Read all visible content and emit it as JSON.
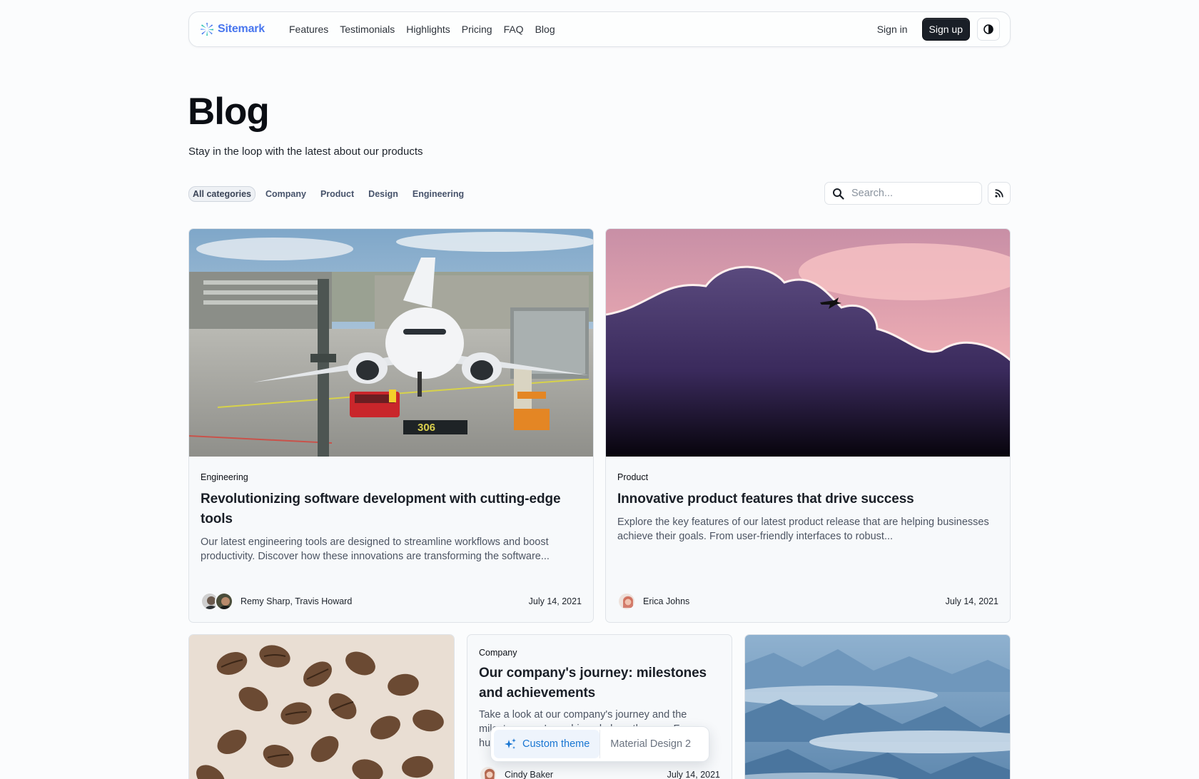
{
  "header": {
    "logo_text": "Sitemark",
    "nav": [
      "Features",
      "Testimonials",
      "Highlights",
      "Pricing",
      "FAQ",
      "Blog"
    ],
    "sign_in": "Sign in",
    "sign_up": "Sign up",
    "theme_icon": "half-moon-icon"
  },
  "hero": {
    "title": "Blog",
    "subtitle": "Stay in the loop with the latest about our products"
  },
  "filters": {
    "categories": [
      "All categories",
      "Company",
      "Product",
      "Design",
      "Engineering"
    ],
    "active": "All categories",
    "search_placeholder": "Search...",
    "search_icon": "search-icon",
    "rss_icon": "rss-feed-icon"
  },
  "cards": [
    {
      "tag": "Engineering",
      "title": "Revolutionizing software development with cutting-edge tools",
      "description": "Our latest engineering tools are designed to streamline workflows and boost productivity. Discover how these innovations are transforming the software...",
      "authors": "Remy Sharp, Travis Howard",
      "date": "July 14, 2021",
      "image": "airplane-at-airport-gate"
    },
    {
      "tag": "Product",
      "title": "Innovative product features that drive success",
      "description": "Explore the key features of our latest product release that are helping businesses achieve their goals. From user-friendly interfaces to robust...",
      "authors": "Erica Johns",
      "date": "July 14, 2021",
      "image": "airplane-over-sunset-clouds"
    },
    {
      "image": "coffee-beans"
    },
    {
      "tag": "Company",
      "title": "Our company's journey: milestones and achievements",
      "description": "Take a look at our company's journey and the milestones we've achieved along the way. From humble beginnings to...",
      "authors": "Cindy Baker",
      "date": "July 14, 2021"
    },
    {
      "image": "mountains-above-clouds"
    }
  ],
  "theme_switcher": {
    "active": "Custom theme",
    "inactive": "Material Design 2",
    "icon": "sparkles-icon"
  },
  "colors": {
    "brand": "#4876ee",
    "accent": "#1976d2",
    "primary_button": "#1a1f27",
    "background": "#fbfcfd"
  }
}
